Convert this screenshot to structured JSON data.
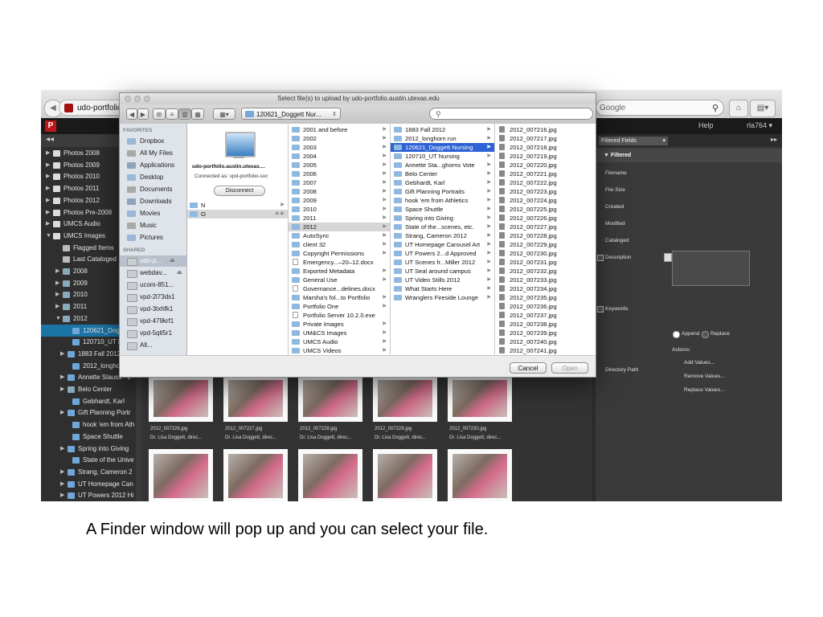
{
  "browser": {
    "tab_label": "udo-portfolio.a",
    "search_placeholder": "Google"
  },
  "app": {
    "logo": "P",
    "help_label": "Help",
    "user_label": "rla764 ▾",
    "side_toggle": "◂◂",
    "sidebar": [
      {
        "label": "Photos 2008",
        "indent": 0,
        "arrow": "▶",
        "kind": "db"
      },
      {
        "label": "Photos 2009",
        "indent": 0,
        "arrow": "▶",
        "kind": "db"
      },
      {
        "label": "Photos 2010",
        "indent": 0,
        "arrow": "▶",
        "kind": "db"
      },
      {
        "label": "Photos 2011",
        "indent": 0,
        "arrow": "▶",
        "kind": "db"
      },
      {
        "label": "Photos 2012",
        "indent": 0,
        "arrow": "▶",
        "kind": "db"
      },
      {
        "label": "Photos Pre-2008",
        "indent": 0,
        "arrow": "▶",
        "kind": "db"
      },
      {
        "label": "UMCS Audio",
        "indent": 0,
        "arrow": "▶",
        "kind": "db"
      },
      {
        "label": "UMCS Images",
        "indent": 0,
        "arrow": "▼",
        "kind": "db"
      },
      {
        "label": "Flagged Items",
        "indent": 1,
        "arrow": "",
        "kind": "list"
      },
      {
        "label": "Last Cataloged",
        "indent": 1,
        "arrow": "",
        "kind": "list"
      },
      {
        "label": "2008",
        "indent": 1,
        "arrow": "▶",
        "kind": "gal"
      },
      {
        "label": "2009",
        "indent": 1,
        "arrow": "▶",
        "kind": "gal"
      },
      {
        "label": "2010",
        "indent": 1,
        "arrow": "▶",
        "kind": "gal"
      },
      {
        "label": "2011",
        "indent": 1,
        "arrow": "▶",
        "kind": "gal"
      },
      {
        "label": "2012",
        "indent": 1,
        "arrow": "▼",
        "kind": "gal"
      },
      {
        "label": "120621_Dogge",
        "indent": 2,
        "arrow": "",
        "kind": "folder",
        "selected": true
      },
      {
        "label": "120710_UT Nu",
        "indent": 2,
        "arrow": "",
        "kind": "folder"
      },
      {
        "label": "1883 Fall 2012",
        "indent": 1.5,
        "arrow": "▶",
        "kind": "folder"
      },
      {
        "label": "2012_longhorn",
        "indent": 2,
        "arrow": "",
        "kind": "folder"
      },
      {
        "label": "Annette Stauss - L",
        "indent": 1.5,
        "arrow": "▶",
        "kind": "folder"
      },
      {
        "label": "Belo Center",
        "indent": 1.5,
        "arrow": "▶",
        "kind": "gal"
      },
      {
        "label": "Gebhardt, Karl",
        "indent": 2,
        "arrow": "",
        "kind": "folder"
      },
      {
        "label": "Gift Planning Portr",
        "indent": 1.5,
        "arrow": "▶",
        "kind": "folder"
      },
      {
        "label": "hook 'em from Ath",
        "indent": 2,
        "arrow": "",
        "kind": "folder"
      },
      {
        "label": "Space Shuttle",
        "indent": 2,
        "arrow": "",
        "kind": "folder"
      },
      {
        "label": "Spring into Giving",
        "indent": 1.5,
        "arrow": "▶",
        "kind": "folder"
      },
      {
        "label": "State of the Unive",
        "indent": 2,
        "arrow": "",
        "kind": "folder"
      },
      {
        "label": "Strang, Cameron 2",
        "indent": 1.5,
        "arrow": "▶",
        "kind": "folder"
      },
      {
        "label": "UT Homepage Can",
        "indent": 1.5,
        "arrow": "▶",
        "kind": "folder"
      },
      {
        "label": "UT Powers 2012 Hi",
        "indent": 1.5,
        "arrow": "▶",
        "kind": "folder"
      }
    ],
    "thumbs_row1": [
      {
        "name": "2012_007226.jpg",
        "caption": "Dr. Lisa Doggett, direc..."
      },
      {
        "name": "2012_007227.jpg",
        "caption": "Dr. Lisa Doggett, direc..."
      },
      {
        "name": "2012_007228.jpg",
        "caption": "Dr. Lisa Doggett, direc..."
      },
      {
        "name": "2012_007229.jpg",
        "caption": "Dr. Lisa Doggett, direc..."
      },
      {
        "name": "2012_007230.jpg",
        "caption": "Dr. Lisa Doggett, direc..."
      }
    ],
    "right_panel": {
      "filter_label": "Filtered Fields",
      "section": "▼ Filtered",
      "fields": [
        "Filename",
        "File Size",
        "Created",
        "Modified",
        "Cataloged",
        "Description",
        "Keywords",
        "Directory Path"
      ],
      "append_label": "Append",
      "replace_label": "Replace",
      "actions_label": "Actions:",
      "actions": [
        "Add Values...",
        "Remove Values...",
        "Replace Values..."
      ]
    }
  },
  "dialog": {
    "title": "Select file(s) to upload by udo-portfolio.austin.utexas.edu",
    "path_label": "120621_Doggett Nur...",
    "search_value": "",
    "favorites_head": "FAVORITES",
    "favorites": [
      {
        "label": "Dropbox",
        "icon": "folder-icon"
      },
      {
        "label": "All My Files",
        "icon": "files-icon"
      },
      {
        "label": "Applications",
        "icon": "apps-icon"
      },
      {
        "label": "Desktop",
        "icon": "desktop-icon"
      },
      {
        "label": "Documents",
        "icon": "documents-icon"
      },
      {
        "label": "Downloads",
        "icon": "downloads-icon"
      },
      {
        "label": "Movies",
        "icon": "movies-icon"
      },
      {
        "label": "Music",
        "icon": "music-icon"
      },
      {
        "label": "Pictures",
        "icon": "pictures-icon"
      }
    ],
    "shared_head": "SHARED",
    "shared": [
      {
        "label": "udo-p...",
        "selected": true,
        "eject": true
      },
      {
        "label": "webdav...",
        "eject": true
      },
      {
        "label": "ucom-851..."
      },
      {
        "label": "vpd-2l73ds1"
      },
      {
        "label": "vpd-3txhfk1"
      },
      {
        "label": "vpd-479krf1"
      },
      {
        "label": "vpd-5qtl5r1"
      },
      {
        "label": "All..."
      }
    ],
    "server": {
      "name": "udo-portfolio.austin.utexas....",
      "connected": "Connected as: vpd-portfolio-svc",
      "disconnect": "Disconnect",
      "volumes": [
        {
          "label": "N",
          "selected": false
        },
        {
          "label": "O",
          "selected": true
        }
      ]
    },
    "col1": [
      {
        "label": "2001 and before",
        "type": "folder",
        "arrow": true
      },
      {
        "label": "2002",
        "type": "folder",
        "arrow": true
      },
      {
        "label": "2003",
        "type": "folder",
        "arrow": true
      },
      {
        "label": "2004",
        "type": "folder",
        "arrow": true
      },
      {
        "label": "2005",
        "type": "folder",
        "arrow": true
      },
      {
        "label": "2006",
        "type": "folder",
        "arrow": true
      },
      {
        "label": "2007",
        "type": "folder",
        "arrow": true
      },
      {
        "label": "2008",
        "type": "folder",
        "arrow": true
      },
      {
        "label": "2009",
        "type": "folder",
        "arrow": true
      },
      {
        "label": "2010",
        "type": "folder",
        "arrow": true
      },
      {
        "label": "2011",
        "type": "folder",
        "arrow": true
      },
      {
        "label": "2012",
        "type": "folder",
        "arrow": true,
        "selected": true
      },
      {
        "label": "AutoSync",
        "type": "folder",
        "arrow": true
      },
      {
        "label": "client 32",
        "type": "folder",
        "arrow": true
      },
      {
        "label": "Copyright Permissions",
        "type": "folder",
        "arrow": true
      },
      {
        "label": "Emergency...–20–12.docx",
        "type": "doc",
        "arrow": false
      },
      {
        "label": "Exported Metadata",
        "type": "folder",
        "arrow": true
      },
      {
        "label": "General Use",
        "type": "folder",
        "arrow": true
      },
      {
        "label": "Governance...delines.docx",
        "type": "doc",
        "arrow": false
      },
      {
        "label": "Marsha's fol...to Portfolio",
        "type": "folder",
        "arrow": true
      },
      {
        "label": "Portfolio One",
        "type": "folder",
        "arrow": true
      },
      {
        "label": "Portfolio Server 10.2.0.exe",
        "type": "doc",
        "arrow": false
      },
      {
        "label": "Private Images",
        "type": "folder",
        "arrow": true
      },
      {
        "label": "UM&CS Images",
        "type": "folder",
        "arrow": true
      },
      {
        "label": "UMCS Audio",
        "type": "folder",
        "arrow": true
      },
      {
        "label": "UMCS Videos",
        "type": "folder",
        "arrow": true
      }
    ],
    "col2": [
      {
        "label": "1883 Fall 2012",
        "arrow": true
      },
      {
        "label": "2012_longhorn run",
        "arrow": true
      },
      {
        "label": "120621_Doggett Nursing",
        "arrow": true,
        "selected": true
      },
      {
        "label": "120710_UT Nursing",
        "arrow": true
      },
      {
        "label": "Annette Sta...ghorns Vote",
        "arrow": true
      },
      {
        "label": "Belo Center",
        "arrow": true
      },
      {
        "label": "Gebhardt, Karl",
        "arrow": true
      },
      {
        "label": "Gift Planning Portraits",
        "arrow": true
      },
      {
        "label": "hook 'em from Athletics",
        "arrow": true
      },
      {
        "label": "Space Shuttle",
        "arrow": true
      },
      {
        "label": "Spring into Giving",
        "arrow": true
      },
      {
        "label": "State of the...scenes, etc.",
        "arrow": true
      },
      {
        "label": "Strang, Cameron 2012",
        "arrow": true
      },
      {
        "label": "UT Homepage Carousel Art",
        "arrow": true
      },
      {
        "label": "UT Powers 2...d Approved",
        "arrow": true
      },
      {
        "label": "UT Scenes fr...Miller 2012",
        "arrow": true
      },
      {
        "label": "UT Seal around campus",
        "arrow": true
      },
      {
        "label": "UT Video Stills 2012",
        "arrow": true
      },
      {
        "label": "What Starts Here",
        "arrow": true
      },
      {
        "label": "Wranglers Fireside Lounge",
        "arrow": true
      }
    ],
    "col3": [
      "2012_007216.jpg",
      "2012_007217.jpg",
      "2012_007218.jpg",
      "2012_007219.jpg",
      "2012_007220.jpg",
      "2012_007221.jpg",
      "2012_007222.jpg",
      "2012_007223.jpg",
      "2012_007224.jpg",
      "2012_007225.jpg",
      "2012_007226.jpg",
      "2012_007227.jpg",
      "2012_007228.jpg",
      "2012_007229.jpg",
      "2012_007230.jpg",
      "2012_007231.jpg",
      "2012_007232.jpg",
      "2012_007233.jpg",
      "2012_007234.jpg",
      "2012_007235.jpg",
      "2012_007236.jpg",
      "2012_007237.jpg",
      "2012_007238.jpg",
      "2012_007239.jpg",
      "2012_007240.jpg",
      "2012_007241.jpg"
    ],
    "cancel_label": "Cancel",
    "open_label": "Open"
  },
  "slide_caption": "A Finder window will pop up and you can select your file."
}
